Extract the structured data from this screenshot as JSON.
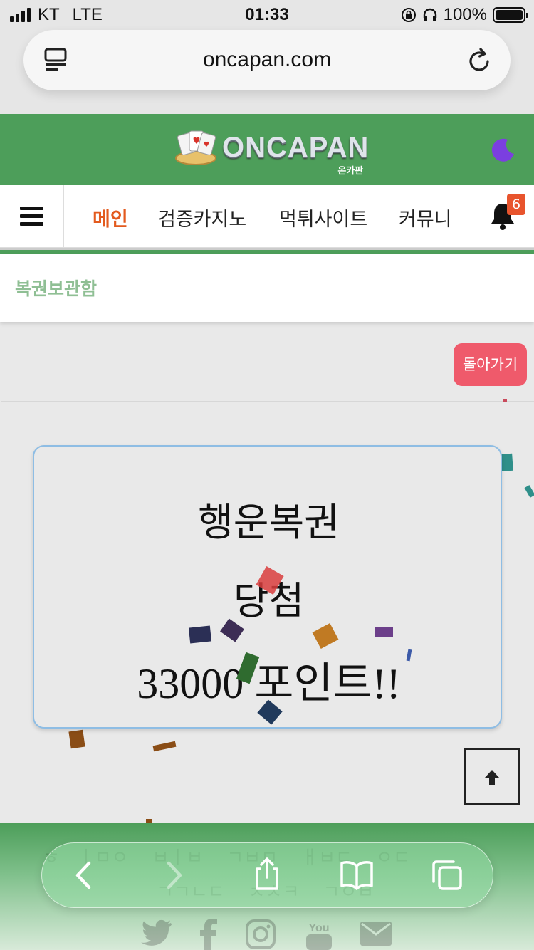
{
  "status_bar": {
    "carrier": "KT",
    "network": "LTE",
    "time": "01:33",
    "battery": "100%"
  },
  "browser": {
    "url": "oncapan.com",
    "icons": [
      "reader-icon",
      "reload-icon"
    ]
  },
  "site": {
    "logo_text": "ONCAPAN",
    "logo_sub": "온카판",
    "dark_mode_icon": "moon-icon"
  },
  "nav": {
    "items": [
      "메인",
      "검증카지노",
      "먹튀사이트",
      "커뮤니"
    ],
    "active_index": 0,
    "notification_count": "6"
  },
  "page": {
    "section_title": "복권보관함",
    "back_label": "돌아가기"
  },
  "result_card": {
    "line1": "행운복권",
    "line2": "당첨",
    "line3": "33000 포인트!!"
  },
  "footer": {
    "social_icons": [
      "twitter-icon",
      "facebook-icon",
      "instagram-icon",
      "youtube-icon",
      "mail-icon"
    ]
  },
  "browser_toolbar": {
    "icons": [
      "back-icon",
      "forward-icon",
      "share-icon",
      "bookmarks-icon",
      "tabs-icon"
    ]
  },
  "colors": {
    "brand_green": "#4d9e5a",
    "active_menu": "#e35a1e",
    "back_button": "#ef5a6b",
    "badge": "#e8542d",
    "moon": "#7b3fe0"
  }
}
